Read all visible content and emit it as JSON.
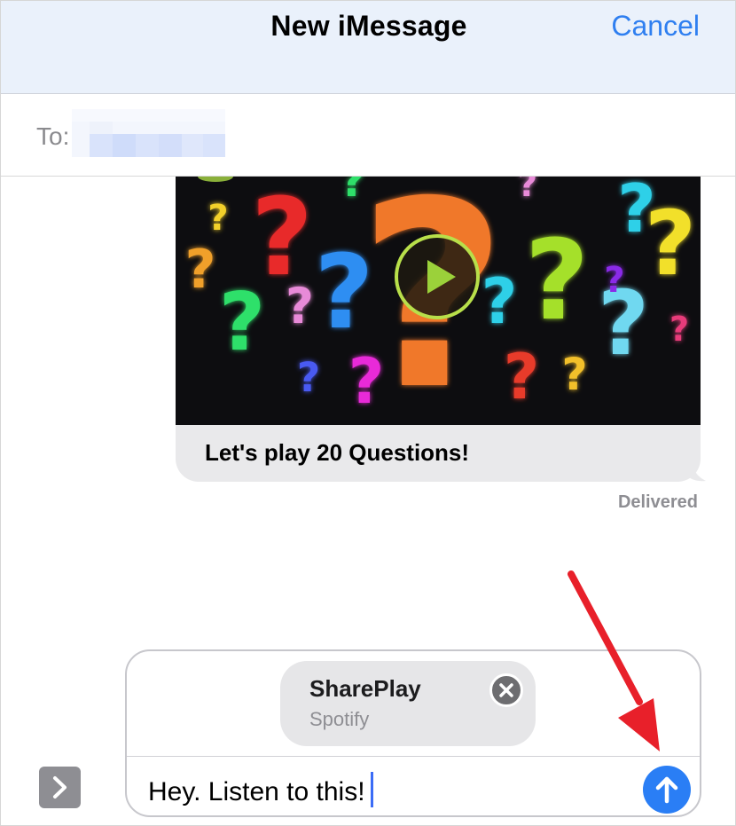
{
  "header": {
    "title": "New iMessage",
    "cancel_label": "Cancel"
  },
  "recipient": {
    "label": "To:",
    "value_redacted": true
  },
  "message": {
    "caption": "Let's play 20 Questions!",
    "media_icon": "play-icon",
    "status": "Delivered"
  },
  "compose": {
    "attachment_title": "SharePlay",
    "attachment_subtitle": "Spotify",
    "remove_icon": "close-icon",
    "text": "Hey. Listen to this!",
    "send_icon": "arrow-up-icon",
    "apps_icon": "chevron-right-icon"
  },
  "colors": {
    "accent": "#2f7ff0",
    "send": "#2a7ef5",
    "bubble": "#e9e9eb",
    "annotation": "#e8202a"
  }
}
